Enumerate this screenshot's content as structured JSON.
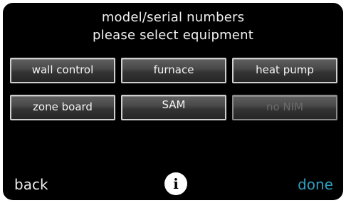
{
  "header": {
    "title_line1": "model/serial numbers",
    "title_line2": "please select equipment"
  },
  "equipment_buttons": [
    {
      "label": "wall control",
      "enabled": true
    },
    {
      "label": "furnace",
      "enabled": true
    },
    {
      "label": "heat pump",
      "enabled": true
    },
    {
      "label": "zone board",
      "enabled": true
    },
    {
      "label": "SAM",
      "enabled": true
    },
    {
      "label": "no NIM",
      "enabled": false
    }
  ],
  "footer": {
    "back_label": "back",
    "info_icon": "info-icon",
    "info_glyph": "i",
    "done_label": "done"
  },
  "colors": {
    "background": "#000000",
    "text": "#f2f2f2",
    "accent_done": "#2f9fc2",
    "disabled_text": "#6a6a6a"
  }
}
